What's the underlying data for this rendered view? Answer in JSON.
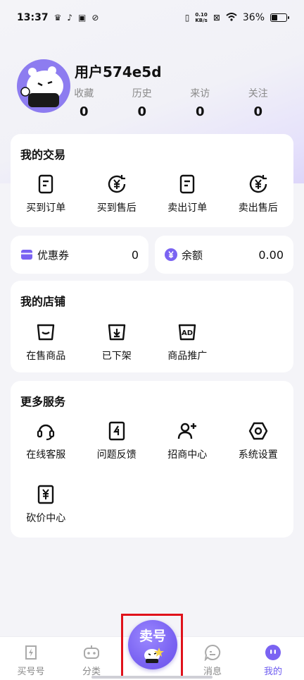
{
  "status_bar": {
    "time": "13:37",
    "net_speed_value": "0.10",
    "net_speed_unit": "KB/s",
    "battery": "36%"
  },
  "profile": {
    "username": "用户574e5d",
    "stats": [
      {
        "label": "收藏",
        "value": "0"
      },
      {
        "label": "历史",
        "value": "0"
      },
      {
        "label": "来访",
        "value": "0"
      },
      {
        "label": "关注",
        "value": "0"
      }
    ]
  },
  "trades": {
    "title": "我的交易",
    "items": [
      {
        "label": "买到订单",
        "icon": "order-doc-icon"
      },
      {
        "label": "买到售后",
        "icon": "yuan-refund-icon"
      },
      {
        "label": "卖出订单",
        "icon": "order-doc-icon"
      },
      {
        "label": "卖出售后",
        "icon": "yuan-refund-icon"
      }
    ]
  },
  "coupon": {
    "label": "优惠券",
    "value": "0"
  },
  "balance": {
    "label": "余额",
    "value": "0.00"
  },
  "shop": {
    "title": "我的店铺",
    "items": [
      {
        "label": "在售商品",
        "icon": "on-sale-icon"
      },
      {
        "label": "已下架",
        "icon": "off-shelf-icon"
      },
      {
        "label": "商品推广",
        "icon": "ad-icon"
      }
    ]
  },
  "services": {
    "title": "更多服务",
    "items": [
      {
        "label": "在线客服",
        "icon": "headset-icon"
      },
      {
        "label": "问题反馈",
        "icon": "feedback-icon"
      },
      {
        "label": "招商中心",
        "icon": "add-user-icon"
      },
      {
        "label": "系统设置",
        "icon": "settings-icon"
      },
      {
        "label": "砍价中心",
        "icon": "bargain-icon"
      }
    ]
  },
  "tabbar": {
    "tabs": [
      {
        "label": "买号号",
        "icon": "bolt-icon"
      },
      {
        "label": "分类",
        "icon": "robot-icon"
      },
      {
        "label": "消息",
        "icon": "message-icon"
      },
      {
        "label": "我的",
        "icon": "profile-icon"
      }
    ],
    "center_label": "卖号",
    "active_color": "#6d5bf0"
  },
  "colors": {
    "accent": "#7a63f2",
    "highlight_border": "#e0121b"
  }
}
